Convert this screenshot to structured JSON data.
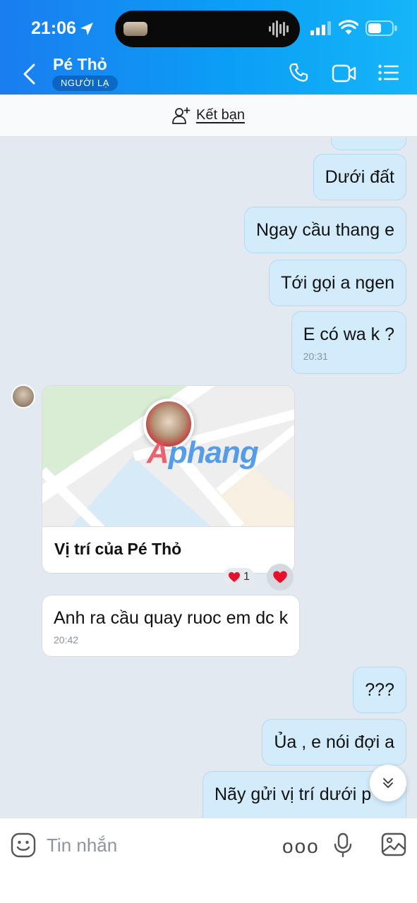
{
  "status_bar": {
    "time": "21:06"
  },
  "header": {
    "contact_name": "Pé Thỏ",
    "badge": "NGƯỜI LẠ",
    "icons": [
      "back-icon",
      "phone-icon",
      "video-call-icon",
      "menu-icon"
    ]
  },
  "add_friend": {
    "label": "Kết bạn"
  },
  "messages": [
    {
      "side": "out",
      "text": "Dưới đất"
    },
    {
      "side": "out",
      "text": "Ngay cầu thang e"
    },
    {
      "side": "out",
      "text": "Tới gọi a ngen"
    },
    {
      "side": "out",
      "text": "E có wa k ?",
      "time": "20:31"
    },
    {
      "side": "in",
      "type": "location",
      "label": "Vị trí của Pé Thỏ",
      "reaction_count": "1"
    },
    {
      "side": "in",
      "text": "Anh ra cầu quay ruoc em dc k",
      "time": "20:42"
    },
    {
      "side": "out",
      "text": "???"
    },
    {
      "side": "out",
      "text": "Ủa , e nói đợi a"
    },
    {
      "side": "out",
      "text": "Nãy gửi vị trí dưới p"
    }
  ],
  "watermark": {
    "first": "A",
    "rest": "phang"
  },
  "composer": {
    "placeholder": "Tin nhắn",
    "more": "ooo"
  },
  "colors": {
    "header_start": "#1a7df0",
    "header_end": "#15b6f8",
    "outgoing_bubble": "#d2ecfc",
    "incoming_bubble": "#ffffff",
    "chat_bg": "#e2e9f1"
  }
}
